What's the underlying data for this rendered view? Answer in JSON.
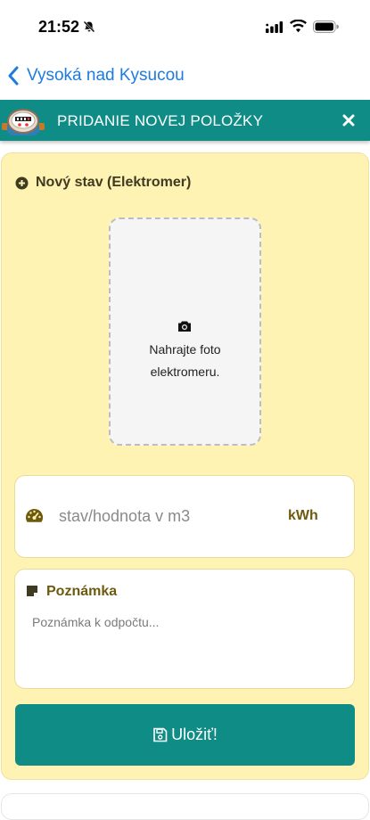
{
  "status_bar": {
    "time": "21:52"
  },
  "nav": {
    "back_label": "Vysoká nad Kysucou"
  },
  "modal": {
    "title": "PRIDANIE NOVEJ POLOŽKY"
  },
  "form": {
    "section_title": "Nový stav (Elektromer)",
    "photo_prompt_line1": "Nahrajte foto",
    "photo_prompt_line2": "elektromeru.",
    "value_placeholder": "stav/hodnota v m3",
    "value_unit": "kWh",
    "note_label": "Poznámka",
    "note_placeholder": "Poznámka k odpočtu...",
    "save_label": "Uložiť!"
  },
  "colors": {
    "teal": "#0f8c86",
    "card_bg": "#fff3b3",
    "link_blue": "#1e7be0",
    "label_brown": "#6e5a0f"
  },
  "icons": [
    "bell-slash-icon",
    "cellular-signal-icon",
    "wifi-icon",
    "battery-icon",
    "chevron-left-icon",
    "water-meter-icon",
    "close-icon",
    "plus-circle-icon",
    "camera-icon",
    "gauge-icon",
    "note-icon",
    "save-icon"
  ]
}
